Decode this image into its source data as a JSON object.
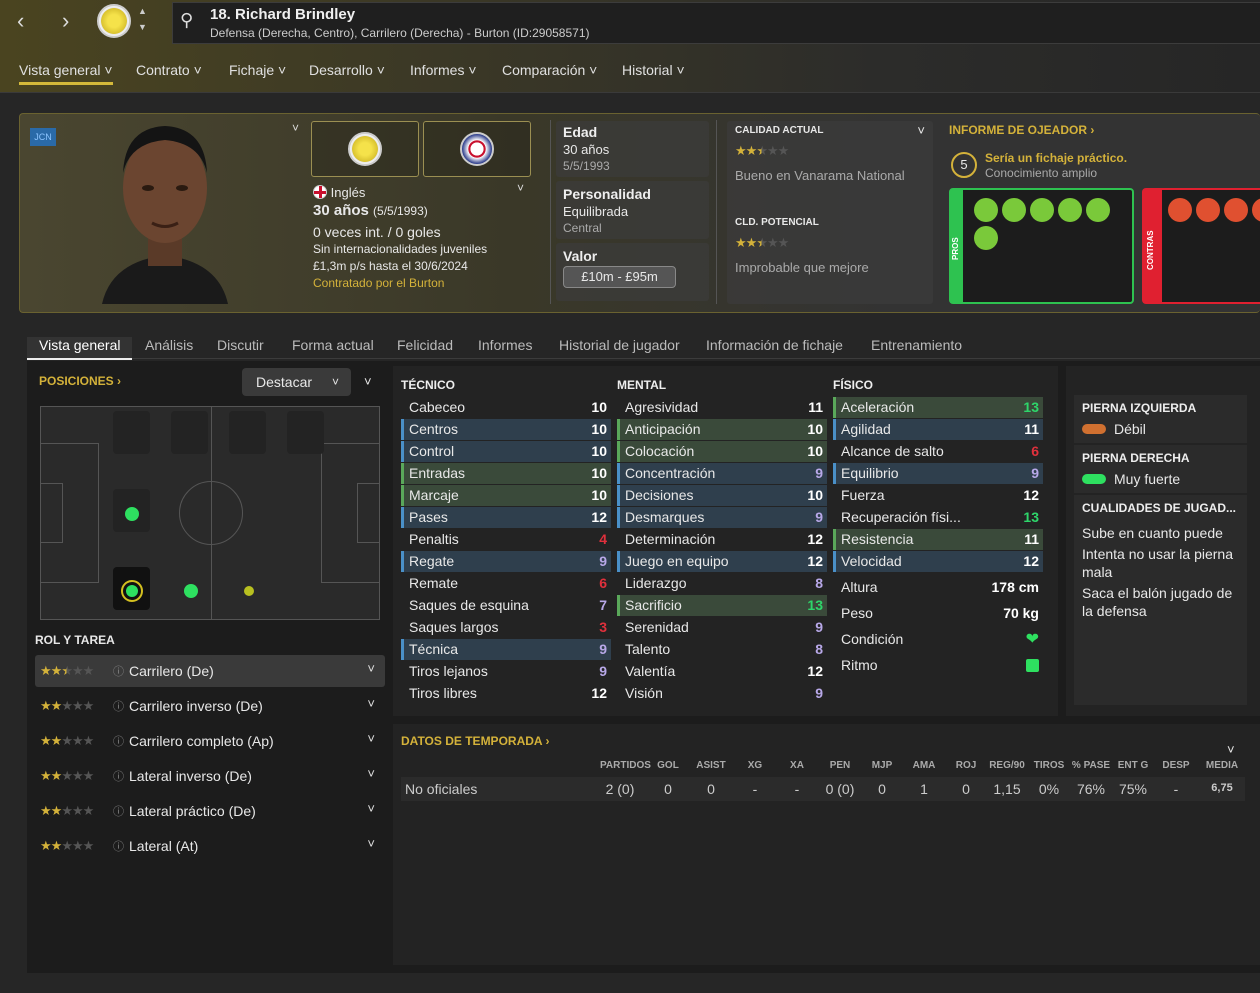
{
  "header": {
    "player_name": "18. Richard Brindley",
    "player_subtitle": "Defensa (Derecha, Centro), Carrilero (Derecha) - Burton (ID:29058571)"
  },
  "menu": [
    "Vista general",
    "Contrato",
    "Fichaje",
    "Desarrollo",
    "Informes",
    "Comparación",
    "Historial"
  ],
  "profile": {
    "tag": "JCN",
    "nationality": "Inglés",
    "age_line": "30 años",
    "dob_paren": "(5/5/1993)",
    "caps": "0 veces int. / 0 goles",
    "youth": "Sin internacionalidades juveniles",
    "wage": "£1,3m p/s hasta el 30/6/2024",
    "signed": "Contratado por el Burton"
  },
  "details": {
    "age_label": "Edad",
    "age_value": "30 años",
    "age_dob": "5/5/1993",
    "personality_label": "Personalidad",
    "personality_value": "Equilibrada",
    "personality_sub": "Central",
    "value_label": "Valor",
    "value_range": "£10m - £95m"
  },
  "ability": {
    "current_label": "CALIDAD ACTUAL",
    "current_text": "Bueno en Vanarama National",
    "current_stars": 2.5,
    "potential_label": "CLD. POTENCIAL",
    "potential_text": "Improbable que mejore",
    "potential_stars": 2.5
  },
  "scout": {
    "title": "INFORME DE OJEADOR",
    "score": "5",
    "headline": "Sería un fichaje práctico.",
    "knowledge": "Conocimiento amplio",
    "pros_label": "PROS",
    "cons_label": "CONTRAS"
  },
  "tabs": [
    "Vista general",
    "Análisis",
    "Discutir",
    "Forma actual",
    "Felicidad",
    "Informes",
    "Historial de jugador",
    "Información de fichaje",
    "Entrenamiento"
  ],
  "positions": {
    "title": "POSICIONES",
    "highlight_select": "Destacar"
  },
  "roles": {
    "title": "ROL Y TAREA",
    "items": [
      {
        "name": "Carrilero (De)",
        "stars": 2.5
      },
      {
        "name": "Carrilero inverso (De)",
        "stars": 2
      },
      {
        "name": "Carrilero completo (Ap)",
        "stars": 2
      },
      {
        "name": "Lateral inverso (De)",
        "stars": 2
      },
      {
        "name": "Lateral práctico (De)",
        "stars": 2
      },
      {
        "name": "Lateral (At)",
        "stars": 2
      }
    ]
  },
  "attributes": {
    "technical_title": "TÉCNICO",
    "mental_title": "MENTAL",
    "physical_title": "FÍSICO",
    "technical": [
      {
        "name": "Cabeceo",
        "value": "10",
        "hl": "",
        "c": "white"
      },
      {
        "name": "Centros",
        "value": "10",
        "hl": "blue",
        "c": "white"
      },
      {
        "name": "Control",
        "value": "10",
        "hl": "blue",
        "c": "white"
      },
      {
        "name": "Entradas",
        "value": "10",
        "hl": "green",
        "c": "white"
      },
      {
        "name": "Marcaje",
        "value": "10",
        "hl": "green",
        "c": "white"
      },
      {
        "name": "Pases",
        "value": "12",
        "hl": "blue",
        "c": "white"
      },
      {
        "name": "Penaltis",
        "value": "4",
        "hl": "",
        "c": "red"
      },
      {
        "name": "Regate",
        "value": "9",
        "hl": "blue",
        "c": "purple"
      },
      {
        "name": "Remate",
        "value": "6",
        "hl": "",
        "c": "red"
      },
      {
        "name": "Saques de esquina",
        "value": "7",
        "hl": "",
        "c": "purple"
      },
      {
        "name": "Saques largos",
        "value": "3",
        "hl": "",
        "c": "red"
      },
      {
        "name": "Técnica",
        "value": "9",
        "hl": "blue",
        "c": "purple"
      },
      {
        "name": "Tiros lejanos",
        "value": "9",
        "hl": "",
        "c": "purple"
      },
      {
        "name": "Tiros libres",
        "value": "12",
        "hl": "",
        "c": "white"
      }
    ],
    "mental": [
      {
        "name": "Agresividad",
        "value": "11",
        "hl": "",
        "c": "white"
      },
      {
        "name": "Anticipación",
        "value": "10",
        "hl": "green",
        "c": "white"
      },
      {
        "name": "Colocación",
        "value": "10",
        "hl": "green",
        "c": "white"
      },
      {
        "name": "Concentración",
        "value": "9",
        "hl": "blue",
        "c": "purple"
      },
      {
        "name": "Decisiones",
        "value": "10",
        "hl": "blue",
        "c": "white"
      },
      {
        "name": "Desmarques",
        "value": "9",
        "hl": "blue",
        "c": "purple"
      },
      {
        "name": "Determinación",
        "value": "12",
        "hl": "",
        "c": "white"
      },
      {
        "name": "Juego en equipo",
        "value": "12",
        "hl": "blue",
        "c": "white"
      },
      {
        "name": "Liderazgo",
        "value": "8",
        "hl": "",
        "c": "purple"
      },
      {
        "name": "Sacrificio",
        "value": "13",
        "hl": "green",
        "c": "green"
      },
      {
        "name": "Serenidad",
        "value": "9",
        "hl": "",
        "c": "purple"
      },
      {
        "name": "Talento",
        "value": "8",
        "hl": "",
        "c": "purple"
      },
      {
        "name": "Valentía",
        "value": "12",
        "hl": "",
        "c": "white"
      },
      {
        "name": "Visión",
        "value": "9",
        "hl": "",
        "c": "purple"
      }
    ],
    "physical": [
      {
        "name": "Aceleración",
        "value": "13",
        "hl": "green",
        "c": "green"
      },
      {
        "name": "Agilidad",
        "value": "11",
        "hl": "blue",
        "c": "white"
      },
      {
        "name": "Alcance de salto",
        "value": "6",
        "hl": "",
        "c": "red"
      },
      {
        "name": "Equilibrio",
        "value": "9",
        "hl": "blue",
        "c": "purple"
      },
      {
        "name": "Fuerza",
        "value": "12",
        "hl": "",
        "c": "white"
      },
      {
        "name": "Recuperación físi...",
        "value": "13",
        "hl": "",
        "c": "green"
      },
      {
        "name": "Resistencia",
        "value": "11",
        "hl": "green",
        "c": "white"
      },
      {
        "name": "Velocidad",
        "value": "12",
        "hl": "blue",
        "c": "white"
      }
    ],
    "extra": [
      {
        "name": "Altura",
        "value": "178 cm"
      },
      {
        "name": "Peso",
        "value": "70 kg"
      },
      {
        "name": "Condición",
        "value": ""
      },
      {
        "name": "Ritmo",
        "value": ""
      }
    ]
  },
  "feet": {
    "left_label": "PIERNA IZQUIERDA",
    "left_value": "Débil",
    "right_label": "PIERNA DERECHA",
    "right_value": "Muy fuerte",
    "traits_label": "CUALIDADES DE JUGAD...",
    "traits": [
      "Sube en cuanto puede",
      "Intenta no usar la pierna mala",
      "Saca el balón jugado de la defensa"
    ]
  },
  "season": {
    "title": "DATOS DE TEMPORADA",
    "headers": [
      "PARTIDOS",
      "GOL",
      "ASIST",
      "XG",
      "XA",
      "PEN",
      "MJP",
      "AMA",
      "ROJ",
      "REG/90",
      "TIROS",
      "% PASE",
      "ENT G",
      "DESP",
      "MEDIA"
    ],
    "row_label": "No oficiales",
    "row": [
      "2 (0)",
      "0",
      "0",
      "-",
      "-",
      "0 (0)",
      "0",
      "1",
      "0",
      "1,15",
      "0%",
      "76%",
      "75%",
      "-",
      "6,75"
    ]
  },
  "colors": {
    "accent": "#d4b23a",
    "green": "#2ed66a",
    "red": "#e0303c",
    "purple": "#b8a8e8",
    "blue": "#4a90c8"
  }
}
